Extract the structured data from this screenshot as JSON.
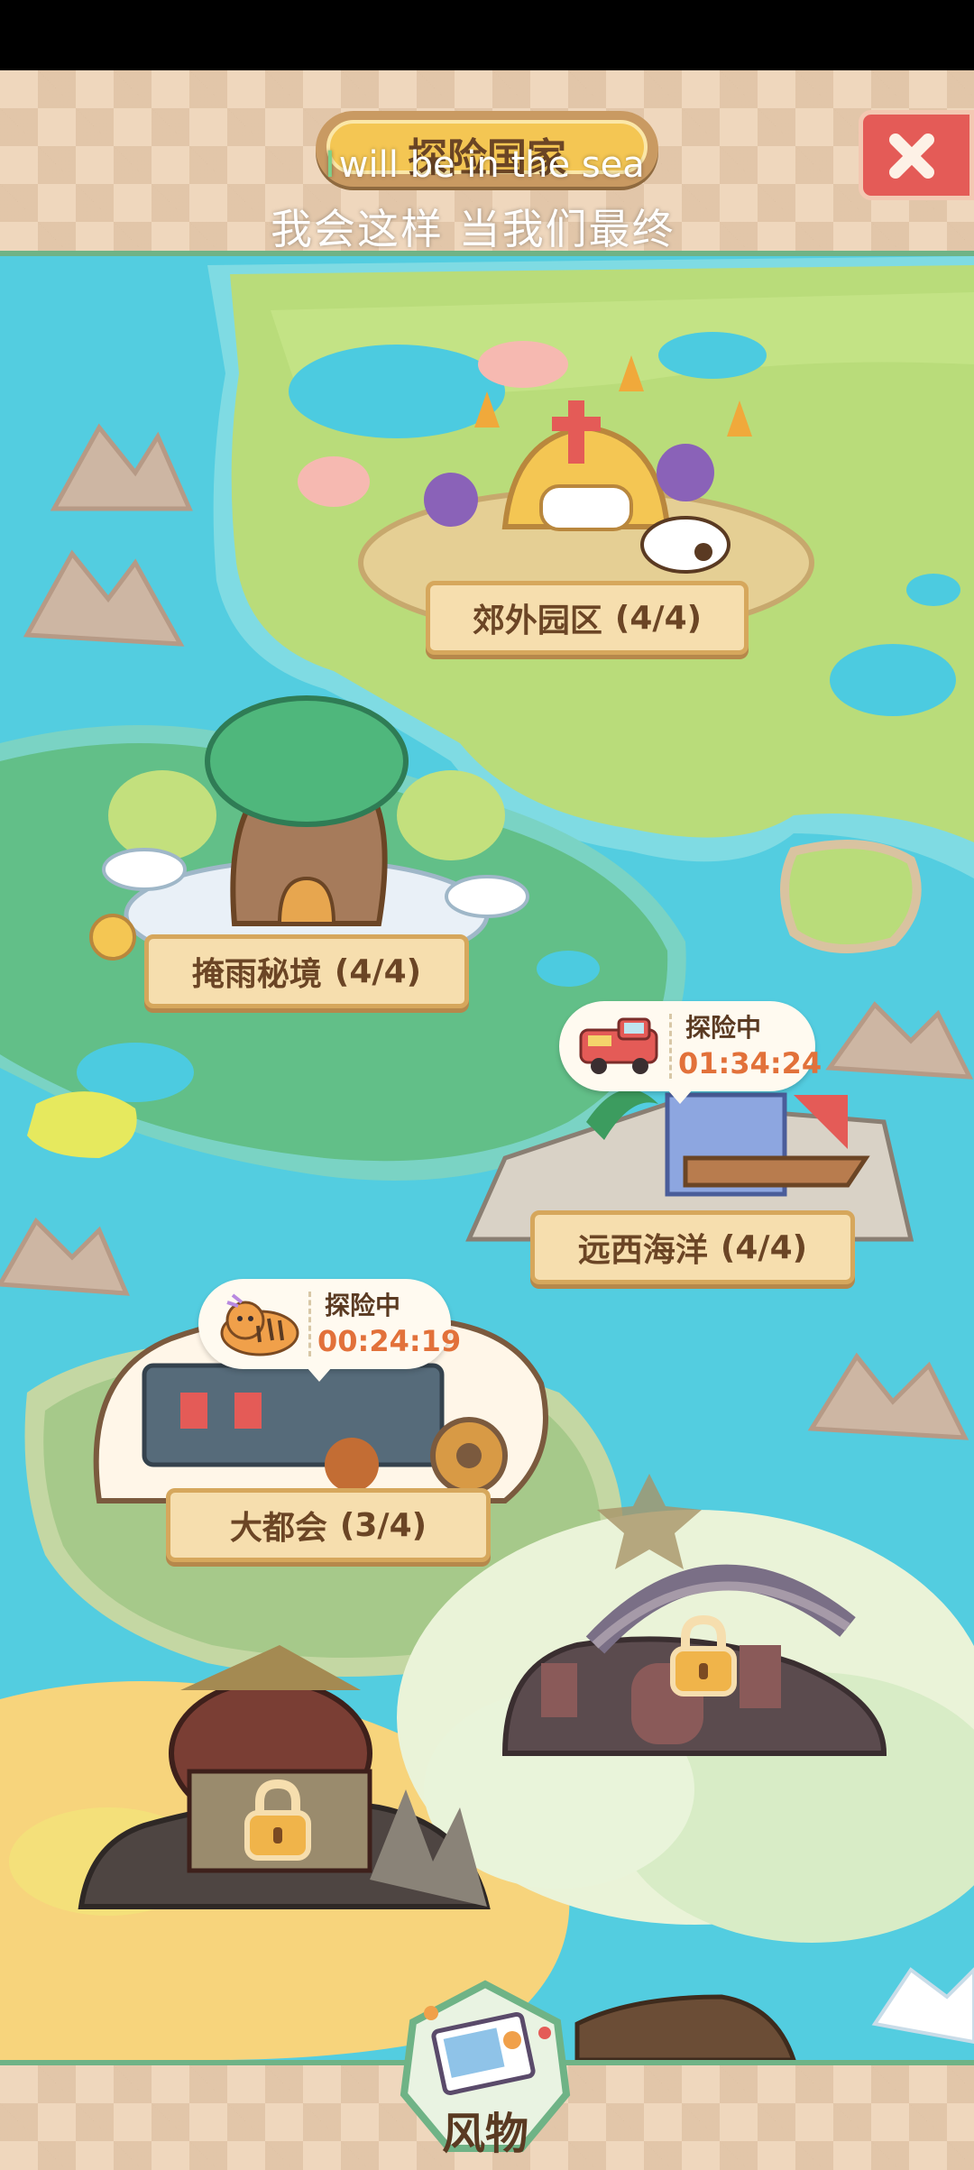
{
  "header": {
    "title": "探险国家",
    "close_icon": "close-icon"
  },
  "lyrics": {
    "line1_cursor": "I",
    "line1": "will be in the sea",
    "line2": "我会这样 当我们最终"
  },
  "regions": [
    {
      "name": "郊外园区",
      "progress": "(4/4)",
      "locked": false
    },
    {
      "name": "掩雨秘境",
      "progress": "(4/4)",
      "locked": false
    },
    {
      "name": "远西海洋",
      "progress": "(4/4)",
      "locked": false
    },
    {
      "name": "大都会",
      "progress": "(3/4)",
      "locked": false
    },
    {
      "name": "",
      "progress": "",
      "locked": true
    },
    {
      "name": "",
      "progress": "",
      "locked": true
    }
  ],
  "expeditions": [
    {
      "status": "探险中",
      "time": "01:34:24",
      "icon": "fire-truck-icon"
    },
    {
      "status": "探险中",
      "time": "00:24:19",
      "icon": "tiger-icon"
    }
  ],
  "footer": {
    "scenery_label": "风物",
    "scenery_icon": "postcard-icon"
  },
  "colors": {
    "sea": "#53cde0",
    "grassland": "#b9dc7a",
    "forest": "#62bf88",
    "sand": "#f7d47c",
    "plate": "#f6deae",
    "timer_text": "#e2713a",
    "close_button": "#e45b57"
  }
}
